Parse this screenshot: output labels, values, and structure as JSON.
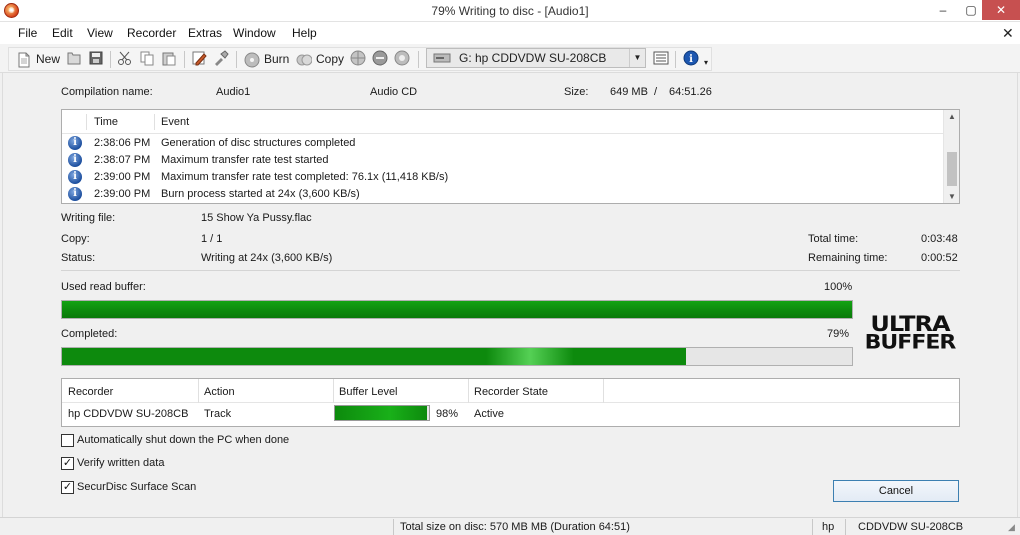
{
  "window": {
    "title": "79% Writing to disc - [Audio1]",
    "app_icon": "nero-burning-rom-icon",
    "minimize": "–",
    "maximize": "▢",
    "close": "✕"
  },
  "menu": {
    "items": [
      "File",
      "Edit",
      "View",
      "Recorder",
      "Extras",
      "Window",
      "Help"
    ],
    "close_doc": "✕"
  },
  "toolbar": {
    "new_label": "New",
    "burn_label": "Burn",
    "copy_label": "Copy",
    "drive_value": "G: hp CDDVDW SU-208CB",
    "icons": [
      "new-icon",
      "open-icon",
      "save-icon",
      "cut-icon",
      "copy-icon",
      "paste-icon",
      "edit-icon",
      "properties-icon",
      "burn-icon",
      "copy-disc-icon",
      "web-icon",
      "eject-icon",
      "drive-icon",
      "list-icon",
      "info-icon"
    ]
  },
  "compilation": {
    "name_label": "Compilation name:",
    "name_value": "Audio1",
    "type_value": "Audio CD",
    "size_label": "Size:",
    "size_value": "649 MB",
    "size_sep": "/",
    "duration_value": "64:51.26"
  },
  "log": {
    "headers": {
      "time": "Time",
      "event": "Event"
    },
    "rows": [
      {
        "time": "2:38:06 PM",
        "event": "Generation of disc structures completed"
      },
      {
        "time": "2:38:07 PM",
        "event": "Maximum transfer rate test started"
      },
      {
        "time": "2:39:00 PM",
        "event": "Maximum transfer rate test completed: 76.1x (11,418 KB/s)"
      },
      {
        "time": "2:39:00 PM",
        "event": "Burn process started at 24x (3,600 KB/s)"
      }
    ]
  },
  "status_info": {
    "writing_file_label": "Writing file:",
    "writing_file_value": "15 Show Ya Pussy.flac",
    "copy_label": "Copy:",
    "copy_value": "1 / 1",
    "status_label": "Status:",
    "status_value": "Writing at 24x (3,600 KB/s)",
    "total_time_label": "Total time:",
    "total_time_value": "0:03:48",
    "remaining_time_label": "Remaining time:",
    "remaining_time_value": "0:00:52"
  },
  "progress": {
    "read_buffer_label": "Used read buffer:",
    "read_buffer_text": "100%",
    "read_buffer_fraction": 1.0,
    "completed_label": "Completed:",
    "completed_text": "79%",
    "completed_fraction": 0.79,
    "logo_line1": "ULTRA",
    "logo_line2": "BUFFER"
  },
  "recorder_table": {
    "headers": {
      "recorder": "Recorder",
      "action": "Action",
      "buffer": "Buffer Level",
      "state": "Recorder State"
    },
    "row": {
      "recorder": "hp CDDVDW SU-208CB",
      "action": "Track",
      "buffer_text": "98%",
      "buffer_fraction": 0.98,
      "state": "Active"
    }
  },
  "options": {
    "auto_shutdown": {
      "label": "Automatically shut down the PC when done",
      "checked": false
    },
    "verify": {
      "label": "Verify written data",
      "checked": true
    },
    "securdisc": {
      "label": "SecurDisc Surface Scan",
      "checked": true
    }
  },
  "cancel_label": "Cancel",
  "statusbar": {
    "total_size": "Total size on disc: 570 MB MB (Duration 64:51)",
    "vendor": "hp",
    "device": "CDDVDW SU-208CB"
  },
  "colors": {
    "progress_green": "#0d8a0d",
    "close_button": "#c75050",
    "cancel_border": "#3c7fb1",
    "info_icon": "#1d4f9e"
  }
}
